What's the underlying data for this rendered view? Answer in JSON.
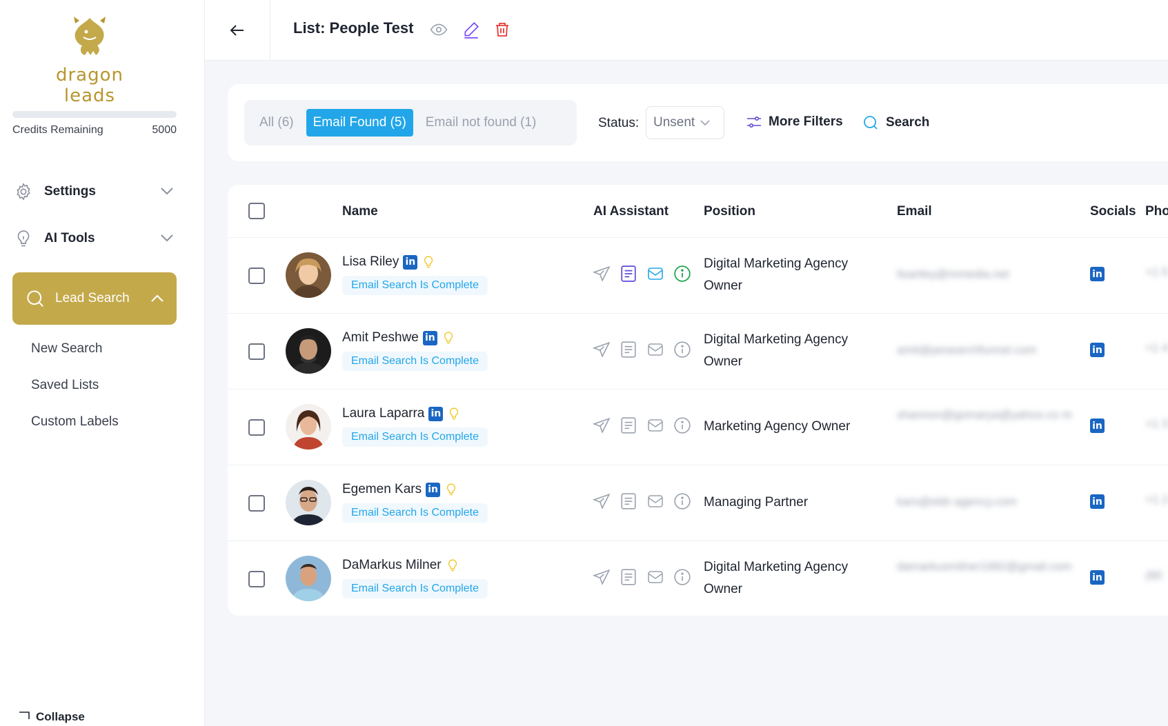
{
  "brand": {
    "name": "dragon leads",
    "accent": "#c4a94b",
    "blue": "#22a6e9"
  },
  "sidebar": {
    "credits_label": "Credits Remaining",
    "credits_value": "5000",
    "items": [
      {
        "label": "Settings",
        "icon": "gear-icon"
      },
      {
        "label": "AI Tools",
        "icon": "lightbulb-icon"
      }
    ],
    "active": {
      "label": "Lead Search",
      "icon": "search-icon"
    },
    "sub_items": [
      "New Search",
      "Saved Lists",
      "Custom Labels"
    ],
    "collapse_label": "Collapse"
  },
  "header": {
    "title": "List: People Test"
  },
  "filters": {
    "tabs": [
      {
        "label": "All (6)",
        "active": false
      },
      {
        "label": "Email Found (5)",
        "active": true
      },
      {
        "label": "Email not found (1)",
        "active": false
      }
    ],
    "status_label": "Status:",
    "status_value": "Unsent",
    "more_filters_label": "More Filters",
    "search_label": "Search"
  },
  "table": {
    "columns": [
      "Name",
      "AI Assistant",
      "Position",
      "Email",
      "Socials",
      "Pho"
    ],
    "rows": [
      {
        "name": "Lisa Riley",
        "linkedin": true,
        "status": "Email Search Is Complete",
        "position": "Digital Marketing Agency Owner",
        "email": "lisariley@mmedia.net",
        "phone": "+1 5",
        "ai_active": true
      },
      {
        "name": "Amit Peshwe",
        "linkedin": true,
        "status": "Email Search Is Complete",
        "position": "Digital Marketing Agency Owner",
        "email": "amit@pesearchfunnel.com",
        "phone": "+1 4",
        "ai_active": false
      },
      {
        "name": "Laura Laparra",
        "linkedin": true,
        "status": "Email Search Is Complete",
        "position": "Marketing Agency Owner",
        "email": "shannon@gomarya@yahoo.co m",
        "phone": "+1 3",
        "ai_active": false
      },
      {
        "name": "Egemen Kars",
        "linkedin": true,
        "status": "Email Search Is Complete",
        "position": "Managing Partner",
        "email": "kars@eldr-agency.com",
        "phone": "+1 2",
        "ai_active": false
      },
      {
        "name": "DaMarkus Milner",
        "linkedin": false,
        "status": "Email Search Is Complete",
        "position": "Digital Marketing Agency Owner",
        "email": "damarkusmilner1992@gmail.com",
        "phone": "(80",
        "ai_active": false
      }
    ]
  }
}
